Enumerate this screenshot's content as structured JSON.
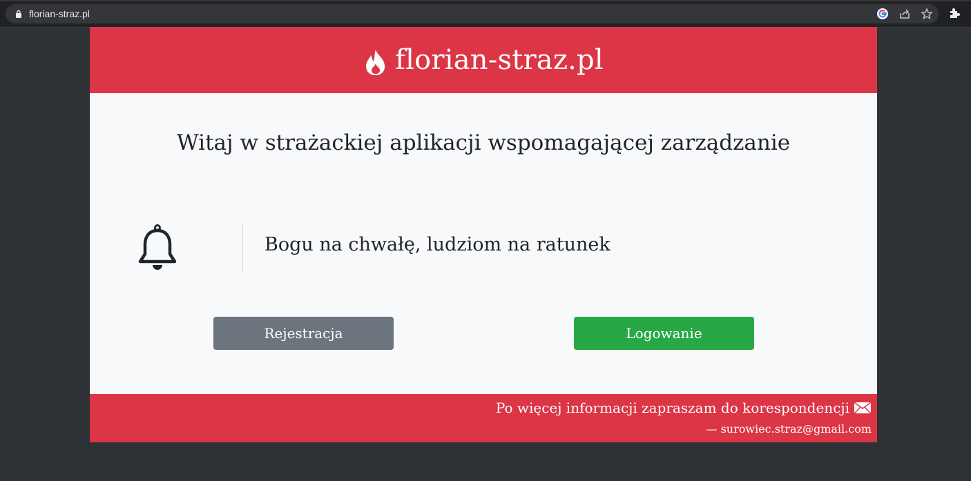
{
  "browser": {
    "url": "florian-straz.pl",
    "icons": [
      "lock-icon",
      "google-icon",
      "share-icon",
      "star-icon",
      "extensions-icon"
    ]
  },
  "header": {
    "brand": "florian-straz.pl",
    "icon": "flame-icon"
  },
  "main": {
    "welcome": "Witaj w strażackiej aplikacji wspomagającej zarządzanie",
    "motto": "Bogu na chwałę, ludziom na ratunek",
    "icon": "bell-icon"
  },
  "buttons": {
    "register": "Rejestracja",
    "login": "Logowanie"
  },
  "footer": {
    "info": "Po więcej informacji zapraszam do korespondencji",
    "email": "— surowiec.straz@gmail.com",
    "icon": "envelope-icon"
  },
  "colors": {
    "primary": "#dc3545",
    "secondary": "#6c757d",
    "success": "#28a745",
    "background": "#2e3135"
  }
}
